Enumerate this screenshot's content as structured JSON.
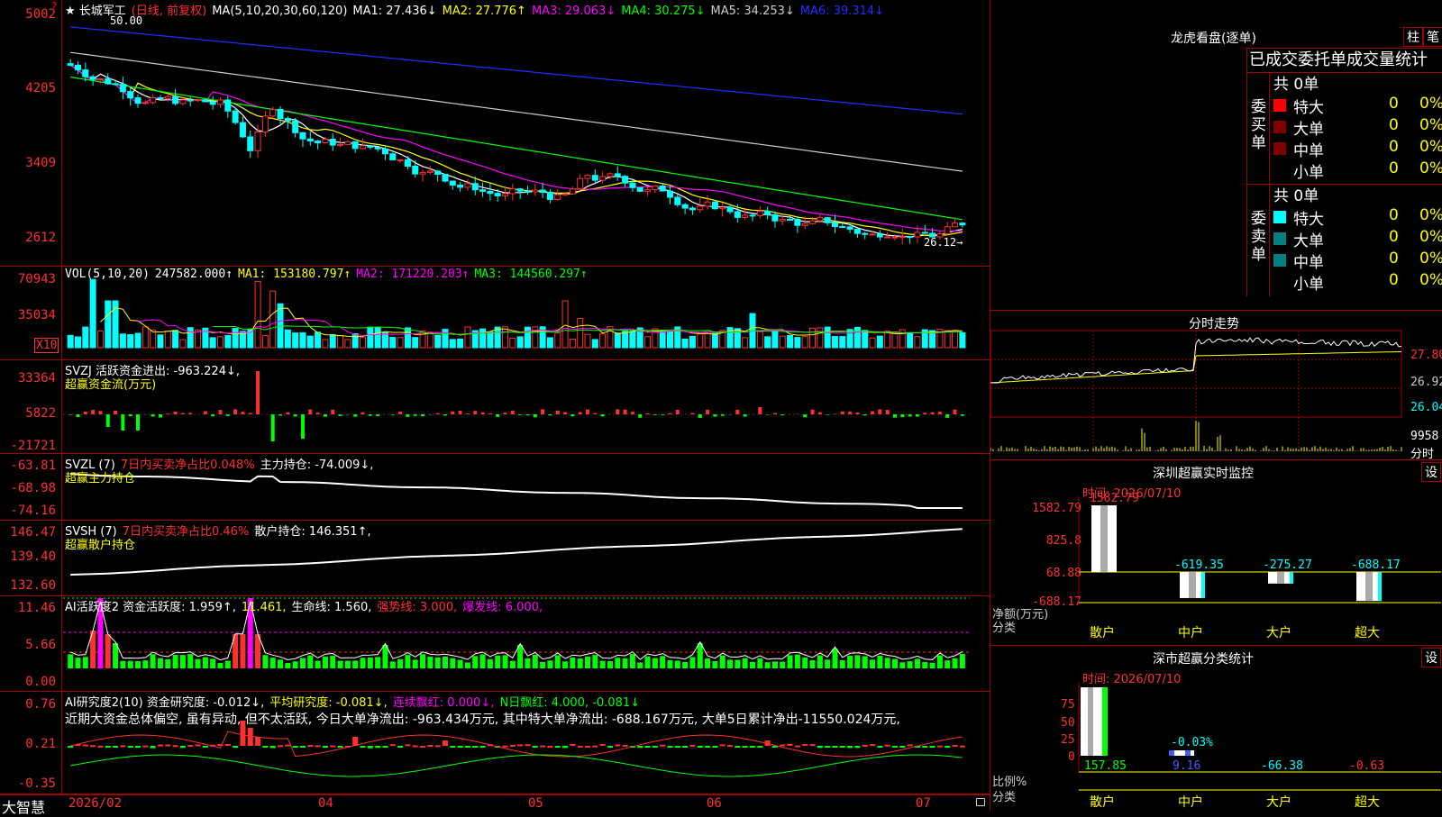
{
  "corner_icon": "?",
  "bottom_logo": "大智慧",
  "x_labels": [
    "2026/02",
    "04",
    "05",
    "06",
    "07"
  ],
  "kline": {
    "title": "★ 长城军工",
    "period": "(日线, 前复权)",
    "ma_label": "MA(5,10,20,30,60,120)",
    "ma_values": [
      {
        "text": "MA1: 27.436↓",
        "color": "#ffffff"
      },
      {
        "text": "MA2: 27.776↑",
        "color": "#ffff00"
      },
      {
        "text": "MA3: 29.063↓",
        "color": "#ff00ff"
      },
      {
        "text": "MA4: 30.275↓",
        "color": "#00ff00"
      },
      {
        "text": "MA5: 34.253↓",
        "color": "#cccccc"
      },
      {
        "text": "MA6: 39.314↓",
        "color": "#2030ff"
      }
    ],
    "y_labels": [
      "5002",
      "4205",
      "3409",
      "2612"
    ],
    "high_label": "50.00",
    "low_label": "26.12→"
  },
  "vol": {
    "title": "VOL(5,10,20)",
    "values": [
      {
        "text": "247582.000↑",
        "color": "#ffffff"
      },
      {
        "text": "MA1: 153180.797↑",
        "color": "#ffff00"
      },
      {
        "text": "MA2: 171220.203↑",
        "color": "#ff00ff"
      },
      {
        "text": "MA3: 144560.297↑",
        "color": "#00ff00"
      }
    ],
    "y_labels": [
      "70943",
      "35034"
    ],
    "unit": "X10"
  },
  "svzj": {
    "title": "SVZJ  活跃资金进出: -963.224↓,",
    "sub": "超赢资金流(万元)",
    "y_labels": [
      "33364",
      "5822",
      "-21721"
    ]
  },
  "svzl": {
    "title_a": "SVZL (7)",
    "title_b": "7日内买卖净占比0.048%",
    "title_c": "主力持仓: -74.009↓,",
    "sub": "超赢主力持仓",
    "y_labels": [
      "-63.81",
      "-68.98",
      "-74.16"
    ]
  },
  "svsh": {
    "title_a": "SVSH (7)",
    "title_b": "7日内买卖净占比0.46%",
    "title_c": "散户持仓: 146.351↑,",
    "sub": "超赢散户持仓",
    "y_labels": [
      "146.47",
      "139.40",
      "132.60"
    ]
  },
  "ai1": {
    "title": "AI活跃度2 资金活跃度: 1.959↑,",
    "v2": "11.461,",
    "v3": "生命线: 1.560,",
    "v4": "强势线: 3.000,",
    "v5": "爆发线: 6.000,",
    "y_labels": [
      "11.46",
      "5.66",
      "0.00"
    ]
  },
  "ai2": {
    "title": "AI研究度2(10) 资金研究度: -0.012↓,",
    "v2": "平均研究度: -0.081↓,",
    "v3": "连续飘红: 0.000↓,",
    "v4": "N日飘红: 4.000, -0.081↓",
    "note": "近期大资金总体偏空, 虽有异动, 但不太活跃, 今日大单净流出: -963.434万元, 其中特大单净流出: -688.167万元, 大单5日累计净出-11550.024万元,",
    "y_labels": [
      "0.76",
      "0.21",
      "-0.35"
    ]
  },
  "longhu": {
    "title": "龙虎看盘(逐单)",
    "btn1": "柱",
    "btn2": "笔",
    "header": "已成交委托单成交量统计",
    "buy_label": "委买单",
    "sell_label": "委卖单",
    "buy_total": "共 0单",
    "sell_total": "共 0单",
    "rows": [
      "特大",
      "大单",
      "中单",
      "小单"
    ],
    "buy_colors": [
      "#ff0000",
      "#800000",
      "#800000",
      ""
    ],
    "sell_colors": [
      "#00ffff",
      "#008080",
      "#008080",
      ""
    ],
    "count": "0",
    "pct": "0%"
  },
  "fenshi": {
    "title": "分时走势",
    "y_labels": [
      "27.80",
      "26.92",
      "26.04"
    ],
    "vol_label": "9958",
    "unit": "分时"
  },
  "monitor": {
    "title": "深圳超赢实时监控",
    "btn": "设",
    "time": "时间: 2026/07/10",
    "y_labels": [
      "1582.79",
      "825.8",
      "68.88",
      "-688.17"
    ],
    "bars": [
      {
        "label": "散户",
        "value": "1582.79",
        "v": 1582.79
      },
      {
        "label": "中户",
        "value": "-619.35",
        "v": -619.35
      },
      {
        "label": "大户",
        "value": "-275.27",
        "v": -275.27
      },
      {
        "label": "超大",
        "value": "-688.17",
        "v": -688.17
      }
    ],
    "axis_title": "净额(万元)",
    "axis_title2": "分类"
  },
  "classify": {
    "title": "深市超赢分类统计",
    "btn": "设",
    "time": "时间: 2026/07/10",
    "y_labels": [
      "75",
      "50",
      "25",
      "0"
    ],
    "inner_label": "-0.03%",
    "bars": [
      {
        "label": "散户",
        "value": "157.85",
        "color": "#00ff00"
      },
      {
        "label": "中户",
        "value": "9.16",
        "color": "#4060ff"
      },
      {
        "label": "大户",
        "value": "-66.38",
        "color": "#00ffff"
      },
      {
        "label": "超大",
        "value": "-0.63",
        "color": "#ff3030"
      }
    ],
    "axis_title": "比例%",
    "axis_title2": "分类"
  }
}
